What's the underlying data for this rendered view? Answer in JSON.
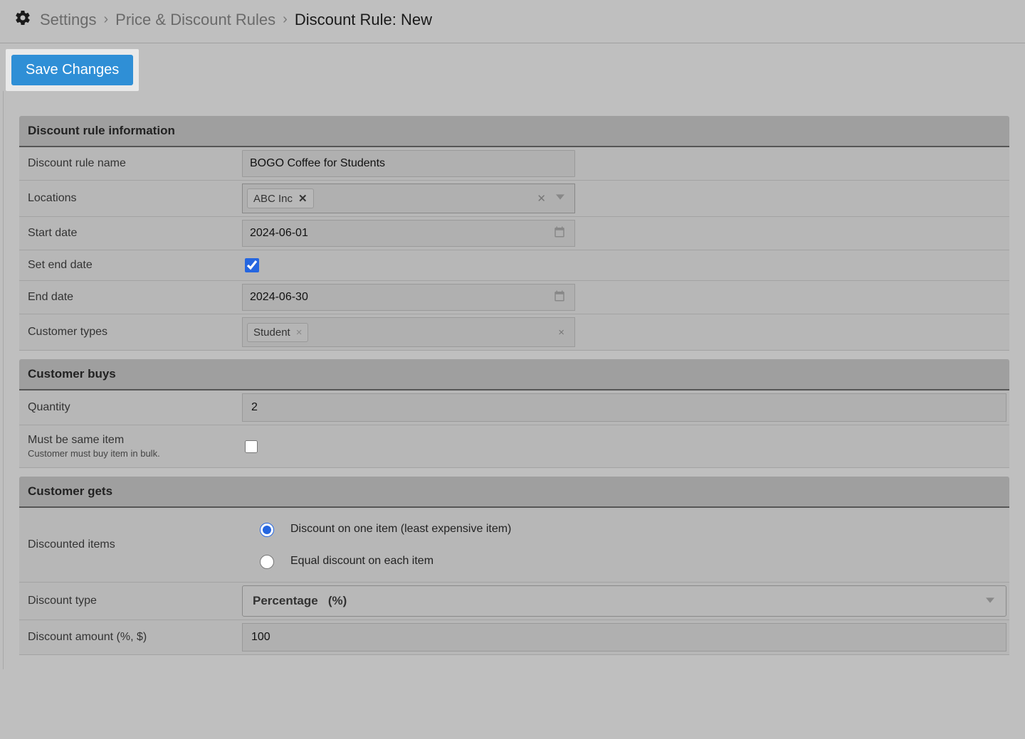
{
  "breadcrumb": {
    "item1": "Settings",
    "item2": "Price & Discount Rules",
    "item3": "Discount Rule: New"
  },
  "actions": {
    "save_label": "Save Changes"
  },
  "sections": {
    "info": {
      "title": "Discount rule information",
      "name_label": "Discount rule name",
      "name_value": "BOGO Coffee for Students",
      "locations_label": "Locations",
      "locations_tag": "ABC Inc",
      "start_label": "Start date",
      "start_value": "2024-06-01",
      "set_end_label": "Set end date",
      "set_end_checked": true,
      "end_label": "End date",
      "end_value": "2024-06-30",
      "customer_types_label": "Customer types",
      "customer_types_tag": "Student"
    },
    "buys": {
      "title": "Customer buys",
      "quantity_label": "Quantity",
      "quantity_value": "2",
      "same_item_label": "Must be same item",
      "same_item_sub": "Customer must buy item in bulk.",
      "same_item_checked": false
    },
    "gets": {
      "title": "Customer gets",
      "discounted_items_label": "Discounted items",
      "radio_one_item": "Discount on one item (least expensive item)",
      "radio_equal": "Equal discount on each item",
      "discount_type_label": "Discount type",
      "discount_type_value": "Percentage   (%)",
      "discount_amount_label": "Discount amount (%, $)",
      "discount_amount_value": "100"
    }
  }
}
